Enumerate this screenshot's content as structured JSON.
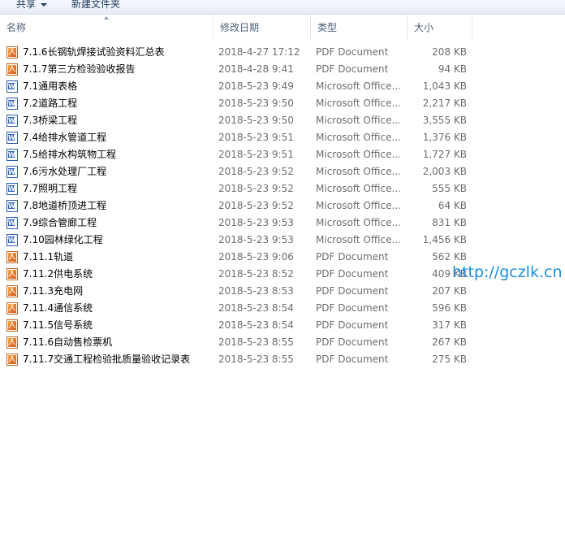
{
  "toolbar": {
    "share_label": "共享",
    "new_folder_label": "新建文件夹"
  },
  "columns": {
    "name": "名称",
    "date": "修改日期",
    "type": "类型",
    "size": "大小"
  },
  "files": [
    {
      "icon": "pdf",
      "name": "7.1.6长钢轨焊接试验资料汇总表",
      "date": "2018-4-27 17:12",
      "type": "PDF Document",
      "size": "208 KB"
    },
    {
      "icon": "pdf",
      "name": "7.1.7第三方检验验收报告",
      "date": "2018-4-28 9:41",
      "type": "PDF Document",
      "size": "94 KB"
    },
    {
      "icon": "doc",
      "name": "7.1通用表格",
      "date": "2018-5-23 9:49",
      "type": "Microsoft Office...",
      "size": "1,043 KB"
    },
    {
      "icon": "doc",
      "name": "7.2道路工程",
      "date": "2018-5-23 9:50",
      "type": "Microsoft Office...",
      "size": "2,217 KB"
    },
    {
      "icon": "doc",
      "name": "7.3桥梁工程",
      "date": "2018-5-23 9:50",
      "type": "Microsoft Office...",
      "size": "3,555 KB"
    },
    {
      "icon": "doc",
      "name": "7.4给排水管道工程",
      "date": "2018-5-23 9:51",
      "type": "Microsoft Office...",
      "size": "1,376 KB"
    },
    {
      "icon": "doc",
      "name": "7.5给排水构筑物工程",
      "date": "2018-5-23 9:51",
      "type": "Microsoft Office...",
      "size": "1,727 KB"
    },
    {
      "icon": "doc",
      "name": "7.6污水处理厂工程",
      "date": "2018-5-23 9:52",
      "type": "Microsoft Office...",
      "size": "2,003 KB"
    },
    {
      "icon": "doc",
      "name": "7.7照明工程",
      "date": "2018-5-23 9:52",
      "type": "Microsoft Office...",
      "size": "555 KB"
    },
    {
      "icon": "doc",
      "name": "7.8地道桥顶进工程",
      "date": "2018-5-23 9:52",
      "type": "Microsoft Office...",
      "size": "64 KB"
    },
    {
      "icon": "doc",
      "name": "7.9综合管廊工程",
      "date": "2018-5-23 9:53",
      "type": "Microsoft Office...",
      "size": "831 KB"
    },
    {
      "icon": "doc",
      "name": "7.10园林绿化工程",
      "date": "2018-5-23 9:53",
      "type": "Microsoft Office...",
      "size": "1,456 KB"
    },
    {
      "icon": "pdf",
      "name": "7.11.1轨道",
      "date": "2018-5-23 9:06",
      "type": "PDF Document",
      "size": "562 KB"
    },
    {
      "icon": "pdf",
      "name": "7.11.2供电系统",
      "date": "2018-5-23 8:52",
      "type": "PDF Document",
      "size": "409 KB"
    },
    {
      "icon": "pdf",
      "name": "7.11.3充电网",
      "date": "2018-5-23 8:53",
      "type": "PDF Document",
      "size": "207 KB"
    },
    {
      "icon": "pdf",
      "name": "7.11.4通信系统",
      "date": "2018-5-23 8:54",
      "type": "PDF Document",
      "size": "596 KB"
    },
    {
      "icon": "pdf",
      "name": "7.11.5信号系统",
      "date": "2018-5-23 8:54",
      "type": "PDF Document",
      "size": "317 KB"
    },
    {
      "icon": "pdf",
      "name": "7.11.6自动售检票机",
      "date": "2018-5-23 8:55",
      "type": "PDF Document",
      "size": "267 KB"
    },
    {
      "icon": "pdf",
      "name": "7.11.7交通工程检验批质量验收记录表",
      "date": "2018-5-23 8:55",
      "type": "PDF Document",
      "size": "275 KB"
    }
  ],
  "watermark": "http://gczlk.cn"
}
